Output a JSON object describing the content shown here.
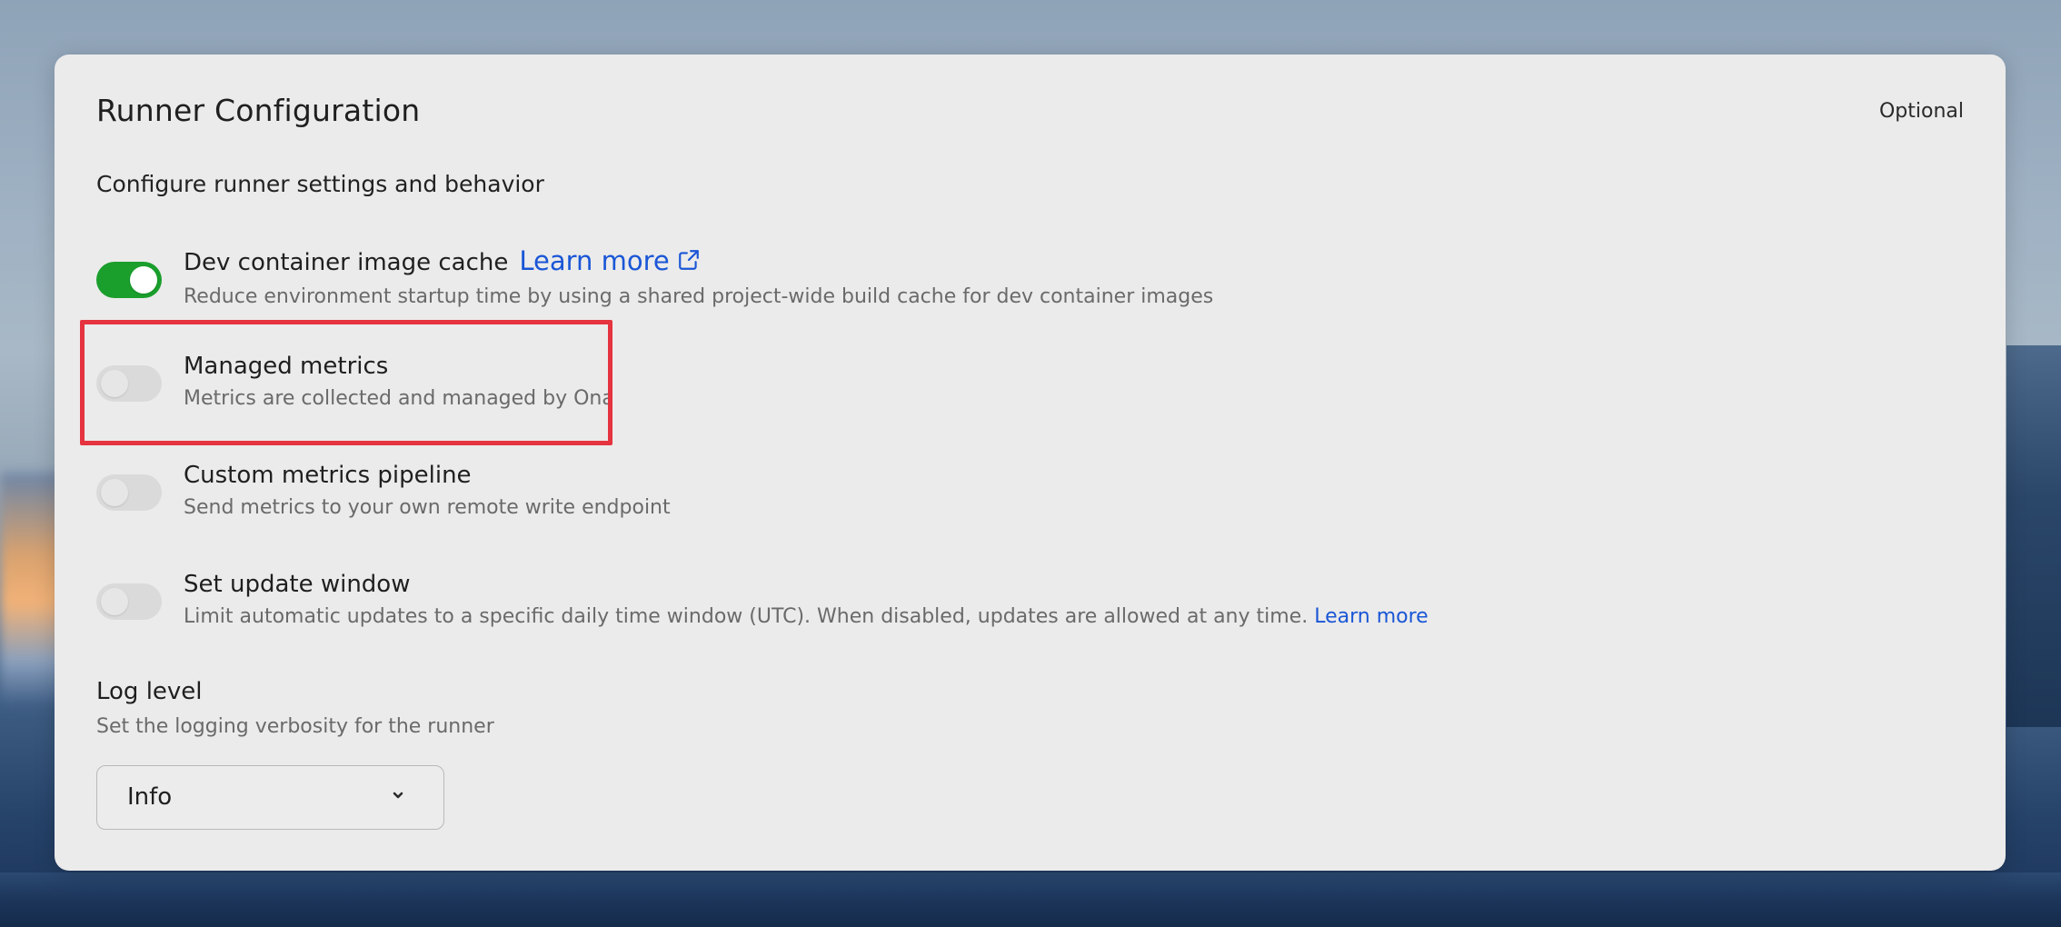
{
  "card": {
    "title": "Runner Configuration",
    "optional_label": "Optional",
    "subtitle": "Configure runner settings and behavior"
  },
  "settings": [
    {
      "label": "Dev container image cache",
      "link": "Learn more",
      "link_icon": "external-link-icon",
      "description": "Reduce environment startup time by using a shared project-wide build cache for dev container images",
      "enabled": true
    },
    {
      "label": "Managed metrics",
      "description": "Metrics are collected and managed by Ona",
      "enabled": false,
      "highlighted": true
    },
    {
      "label": "Custom metrics pipeline",
      "description": "Send metrics to your own remote write endpoint",
      "enabled": false
    },
    {
      "label": "Set update window",
      "description": "Limit automatic updates to a specific daily time window (UTC). When disabled, updates are allowed at any time.",
      "link": "Learn more",
      "enabled": false
    }
  ],
  "log_level": {
    "title": "Log level",
    "description": "Set the logging verbosity for the runner",
    "selected": "Info",
    "icon": "chevron-down-icon"
  },
  "colors": {
    "toggle_on": "#1a9e2c",
    "link": "#1a56d6",
    "highlight": "#e5333f"
  }
}
